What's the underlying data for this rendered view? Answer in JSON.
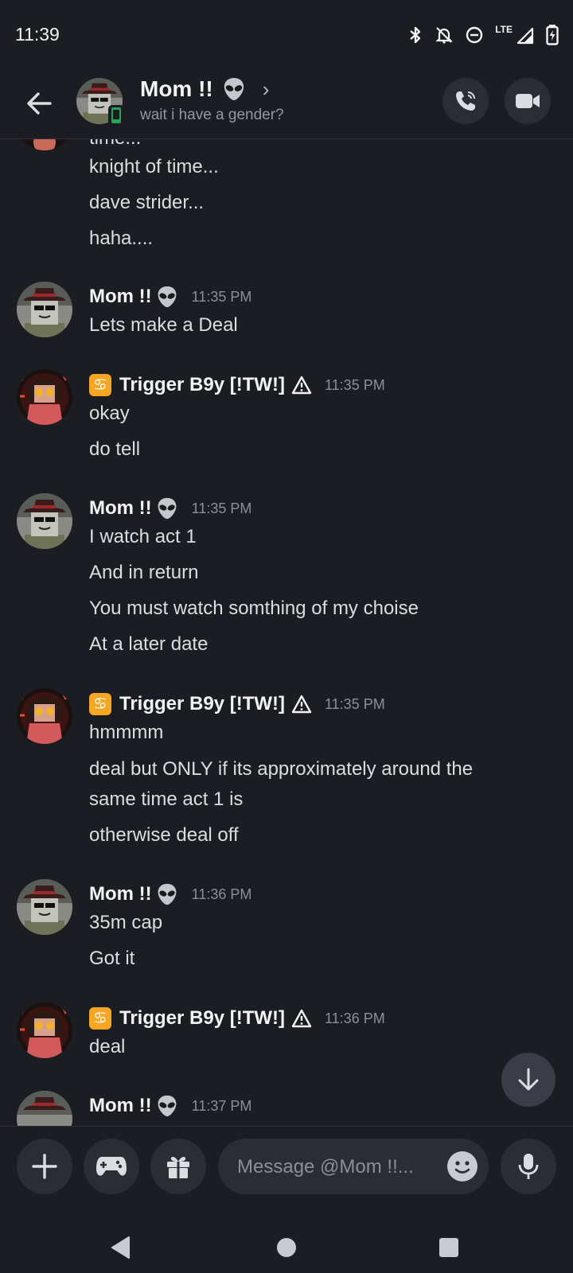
{
  "status_bar": {
    "time": "11:39",
    "network": "LTE"
  },
  "header": {
    "name": "Mom !!",
    "status": "wait i have a gender?",
    "chevron": "›"
  },
  "users": {
    "mom": {
      "name": "Mom !!"
    },
    "trigger": {
      "name": "Trigger B9y [!TW!]",
      "badge": "♋"
    }
  },
  "messages": {
    "top_lines": [
      "time...",
      "knight of time...",
      "dave strider...",
      "haha...."
    ],
    "m1": {
      "author": "Mom !!",
      "time": "11:35 PM",
      "lines": [
        "Lets make a Deal"
      ]
    },
    "m2": {
      "author": "Trigger B9y [!TW!]",
      "time": "11:35 PM",
      "lines": [
        "okay",
        "do tell"
      ]
    },
    "m3": {
      "author": "Mom !!",
      "time": "11:35 PM",
      "lines": [
        "I watch act 1",
        "And in return",
        "You must watch somthing of my choise",
        "At a later date"
      ]
    },
    "m4": {
      "author": "Trigger B9y [!TW!]",
      "time": "11:35 PM",
      "lines": [
        "hmmmm",
        "deal but ONLY if its approximately around the",
        "same time act 1 is",
        "otherwise deal off"
      ]
    },
    "m5": {
      "author": "Mom !!",
      "time": "11:36 PM",
      "lines": [
        "35m cap",
        "Got it"
      ]
    },
    "m6": {
      "author": "Trigger B9y [!TW!]",
      "time": "11:36 PM",
      "lines": [
        "deal"
      ]
    },
    "m7": {
      "author": "Mom !!",
      "time": "11:37 PM"
    }
  },
  "composer": {
    "placeholder": "Message @Mom !!..."
  },
  "icons": {
    "back": "arrow-left-icon",
    "call": "phone-icon",
    "video": "video-icon",
    "add": "plus-icon",
    "apps": "gamepad-icon",
    "gift": "gift-icon",
    "emoji": "emoji-icon",
    "mic": "mic-icon",
    "scroll": "arrow-down-icon"
  },
  "colors": {
    "background": "#1c1d23",
    "surface": "#2b2d34",
    "text": "#dbdee1",
    "muted": "#8c8f96"
  }
}
